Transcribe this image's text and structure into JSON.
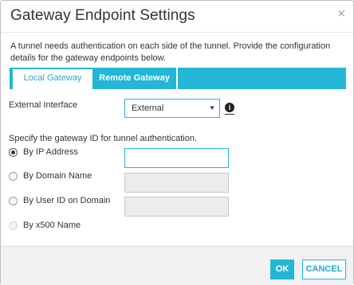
{
  "dialog": {
    "title": "Gateway Endpoint Settings",
    "close_glyph": "×",
    "intro": "A tunnel needs authentication on each side of the tunnel. Provide the configuration details for the gateway endpoints below."
  },
  "tabs": [
    {
      "label": "Local Gateway",
      "active": true
    },
    {
      "label": "Remote Gateway",
      "active": false
    }
  ],
  "external_interface": {
    "label": "External Interface",
    "selected": "External",
    "caret": "▼",
    "info_icon": "info-icon"
  },
  "gateway_id": {
    "heading": "Specify the gateway ID for tunnel authentication.",
    "options": [
      {
        "label": "By IP Address",
        "checked": true,
        "enabled": true,
        "value": ""
      },
      {
        "label": "By Domain Name",
        "checked": false,
        "enabled": true,
        "value": ""
      },
      {
        "label": "By User ID on Domain",
        "checked": false,
        "enabled": true,
        "value": ""
      },
      {
        "label": "By x500 Name",
        "checked": false,
        "enabled": false
      }
    ]
  },
  "footer": {
    "ok_label": "OK",
    "cancel_label": "CANCEL"
  },
  "colors": {
    "accent": "#23b6d6",
    "disabled_field": "#ececec"
  }
}
